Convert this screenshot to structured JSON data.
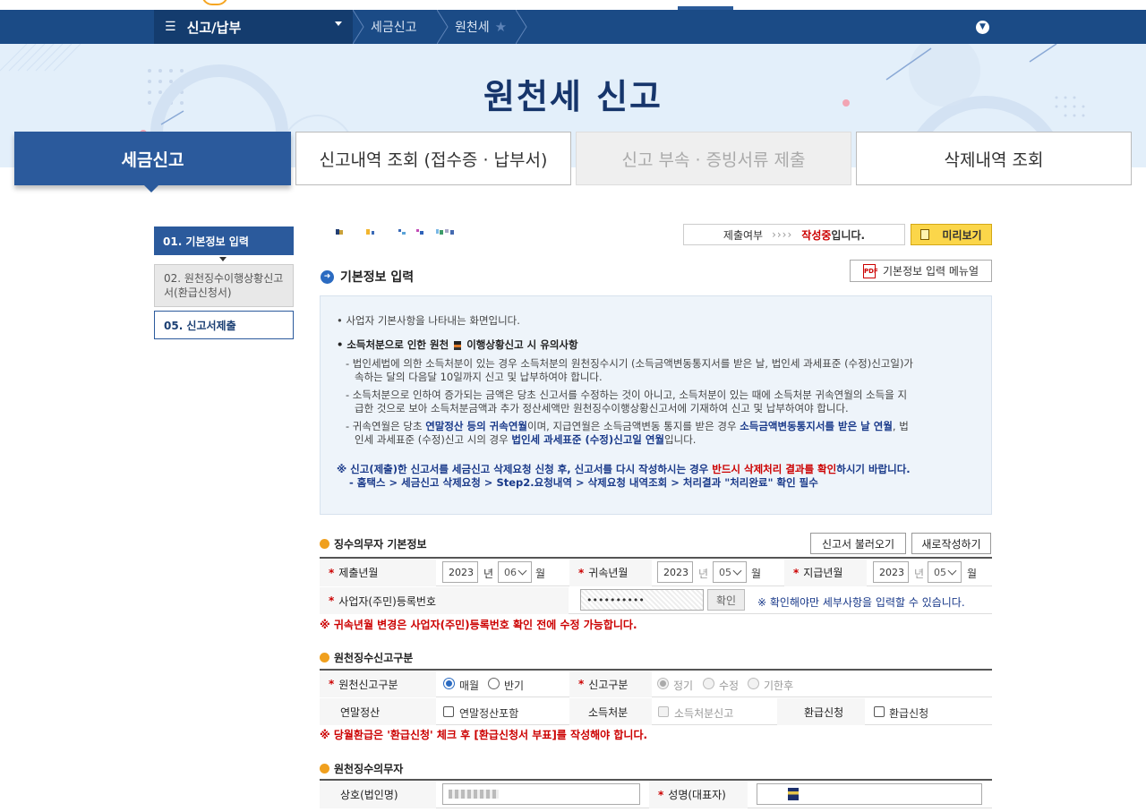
{
  "nav": {
    "menu_label": "신고/납부",
    "breadcrumbs": [
      "세금신고",
      "원천세"
    ]
  },
  "hero": {
    "title": "원천세 신고"
  },
  "tabs": [
    {
      "label": "세금신고",
      "state": "active"
    },
    {
      "label": "신고내역 조회 (접수증 · 납부서)",
      "state": "normal"
    },
    {
      "label": "신고 부속 · 증빙서류 제출",
      "state": "disabled"
    },
    {
      "label": "삭제내역 조회",
      "state": "normal"
    }
  ],
  "steps": [
    {
      "label": "01. 기본정보 입력"
    },
    {
      "label": "02. 원천징수이행상황신고서(환급신청서)"
    },
    {
      "label": "05. 신고서제출"
    }
  ],
  "status": {
    "prefix": "제출여부",
    "arrows": "››››",
    "state": "작성중",
    "suffix": "입니다."
  },
  "preview_label": "미리보기",
  "section": {
    "title": "기본정보 입력",
    "manual_label": "기본정보 입력 메뉴얼"
  },
  "notice": {
    "line1": "• 사업자 기본사항을 나타내는 화면입니다.",
    "line2a": "• 소득처분으로 인한 원천",
    "line2b": "이행상황신고 시 유의사항",
    "l3": "- 법인세법에 의한 소득처분이 있는 경우 소득처분의 원천징수시기 (소득금액변동통지서를 받은 날, 법인세 과세표준 (수정)신고일)가",
    "l4": "속하는 달의 다음달 10일까지 신고 및 납부하여야 합니다.",
    "l5": "- 소득처분으로 인하여 증가되는 금액은 당초 신고서를 수정하는 것이 아니고, 소득처분이 있는 때에 소득처분 귀속연월의 소득을 지",
    "l6": "급한 것으로 보아 소득처분금액과 추가 정산세액만 원천징수이행상황신고서에 기재하여 신고 및 납부하여야 합니다.",
    "l7a": "- 귀속연월은 당초 ",
    "l7b": "연말정산 등의 귀속연월",
    "l7c": "이며, 지급연월은 소득금액변동 통지를 받은 경우 ",
    "l7d": "소득금액변동통지서를 받은 날 연월",
    "l7e": ", 법",
    "l8a": "인세 과세표준 (수정)신고 시의 경우 ",
    "l8b": "법인세 과세표준 (수정)신고일 연월",
    "l8c": "입니다.",
    "l9a": "※ 신고(제출)한 신고서를 세금신고 삭제요청 신청 후, 신고서를 다시 작성하시는 경우 ",
    "l9b": "반드시 삭제처리 결과를 확인",
    "l9c": "하시기 바랍니다.",
    "l10": "- 홈택스 > 세금신고 삭제요청 > Step2.요청내역 > 삭제요청 내역조회 > 처리결과 \"처리완료\" 확인 필수"
  },
  "form1": {
    "title": "징수의무자 기본정보",
    "load_btn": "신고서 불러오기",
    "new_btn": "새로작성하기",
    "submit_ym_label": "제출년월",
    "submit_year": "2023",
    "submit_month": "06",
    "attr_ym_label": "귀속년월",
    "attr_year": "2023",
    "attr_month": "05",
    "pay_ym_label": "지급년월",
    "pay_year": "2023",
    "pay_month": "05",
    "year_unit": "년",
    "month_unit": "월",
    "bizno_label": "사업자(주민)등록번호",
    "bizno_value": "••••••••••",
    "confirm_btn": "확인",
    "confirm_hint": "※ 확인해야만 세부사항을 입력할 수 있습니다.",
    "warning": "※ 귀속년월 변경은 사업자(주민)등록번호 확인 전에 수정 가능합니다."
  },
  "form2": {
    "title": "원천징수신고구분",
    "type_label": "원천신고구분",
    "monthly": "매월",
    "half": "반기",
    "report_label": "신고구분",
    "regular": "정기",
    "amend": "수정",
    "late": "기한후",
    "yearend_label": "연말정산",
    "yearend_chk": "연말정산포함",
    "disposal_label": "소득처분",
    "disposal_chk": "소득처분신고",
    "refund_label": "환급신청",
    "refund_chk": "환급신청",
    "warning": "※ 당월환급은 '환급신청' 체크 후 [환급신청서 부표]를 작성해야 합니다."
  },
  "form3": {
    "title": "원천징수의무자",
    "company_label": "상호(법인명)",
    "rep_label": "성명(대표자)"
  }
}
